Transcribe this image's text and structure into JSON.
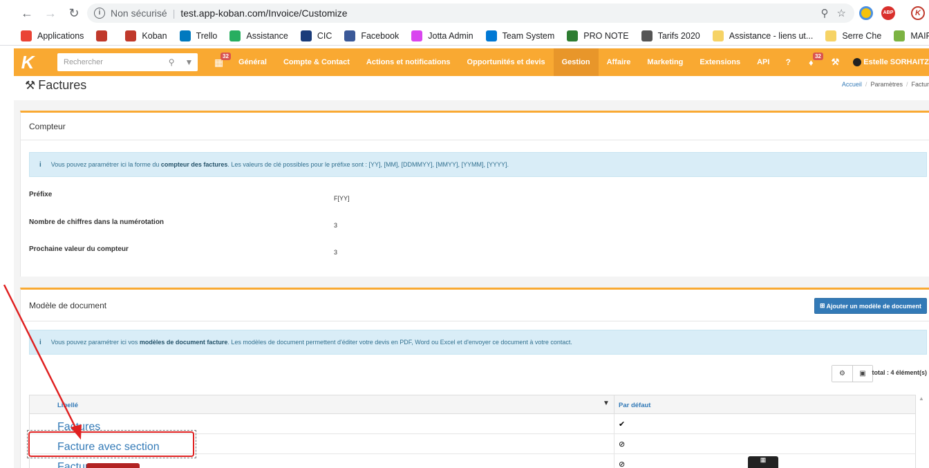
{
  "browser": {
    "insecure_label": "Non sécurisé",
    "url": "test.app-koban.com/Invoice/Customize"
  },
  "bookmarks": [
    {
      "label": "Applications",
      "icon": "apps-grid-icon",
      "color": "#ea4335"
    },
    {
      "label": "",
      "icon": "koban-icon",
      "color": "#c0392b"
    },
    {
      "label": "Koban",
      "icon": "koban-icon",
      "color": "#c0392b"
    },
    {
      "label": "Trello",
      "icon": "trello-icon",
      "color": "#0079bf"
    },
    {
      "label": "Assistance",
      "icon": "assistance-icon",
      "color": "#27ae60"
    },
    {
      "label": "CIC",
      "icon": "cic-icon",
      "color": "#1a3c7a"
    },
    {
      "label": "Facebook",
      "icon": "facebook-icon",
      "color": "#3b5998"
    },
    {
      "label": "Jotta Admin",
      "icon": "jotta-icon",
      "color": "#d946ef"
    },
    {
      "label": "Team System",
      "icon": "team-system-icon",
      "color": "#0078d4"
    },
    {
      "label": "PRO NOTE",
      "icon": "pronote-icon",
      "color": "#2e7d32"
    },
    {
      "label": "Tarifs 2020",
      "icon": "globe-icon",
      "color": "#555555"
    },
    {
      "label": "Assistance - liens ut...",
      "icon": "folder-icon",
      "color": "#f6d365"
    },
    {
      "label": "Serre Che",
      "icon": "folder-icon",
      "color": "#f6d365"
    },
    {
      "label": "MAIRIE",
      "icon": "mairie-icon",
      "color": "#7cb342"
    }
  ],
  "navbar": {
    "search_placeholder": "Rechercher",
    "calendar_badge": "32",
    "menu": [
      "Général",
      "Compte & Contact",
      "Actions et notifications",
      "Opportunités et devis",
      "Gestion",
      "Affaire",
      "Marketing",
      "Extensions",
      "API"
    ],
    "active_menu": "Gestion",
    "notif_badge": "32",
    "user_name": "Estelle SORHAITZ"
  },
  "page": {
    "title": "Factures",
    "breadcrumb": [
      "Accueil",
      "Paramètres",
      "Factur"
    ]
  },
  "counter_panel": {
    "title": "Compteur",
    "alert_pre": "Vous pouvez paramétrer ici la forme du ",
    "alert_bold": "compteur des factures",
    "alert_post": ". Les valeurs de clé possibles pour le préfixe sont : [YY], [MM], [DDMMYY], [MMYY], [YYMM], [YYYY].",
    "fields": [
      {
        "label": "Préfixe",
        "value": "F[YY]"
      },
      {
        "label": "Nombre de chiffres dans la numérotation",
        "value": "3"
      },
      {
        "label": "Prochaine valeur du compteur",
        "value": "3"
      }
    ]
  },
  "template_panel": {
    "title": "Modèle de document",
    "add_button": "Ajouter un modèle de document",
    "alert_pre": "Vous pouvez paramétrer ici vos ",
    "alert_bold": "modèles de document facture",
    "alert_post": ". Les modèles de document permettent d'éditer votre devis en PDF, Word ou Excel et d'envoyer ce document à votre contact.",
    "total": "total : 4 élément(s)",
    "columns": [
      "Libellé",
      "Par défaut"
    ],
    "rows": [
      {
        "label": "Factures",
        "default": "✔"
      },
      {
        "label": "Facture avec section",
        "default": "⊘"
      },
      {
        "label": "Facture a",
        "default": "⊘"
      }
    ]
  },
  "colors": {
    "brand_orange": "#f9a932",
    "active_menu": "#e8962a",
    "link_blue": "#337ab7",
    "highlight_red": "#e02020"
  }
}
